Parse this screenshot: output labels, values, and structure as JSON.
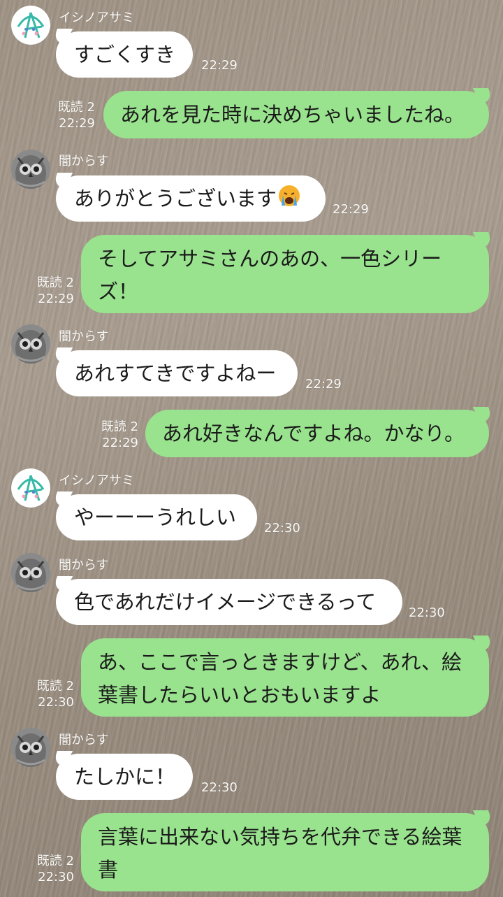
{
  "contacts": {
    "ishino": {
      "name": "イシノアサミ",
      "avatar_icon": "leaf-logo-avatar-icon"
    },
    "yami": {
      "name": "闇からす",
      "avatar_icon": "owl-avatar-icon"
    }
  },
  "messages": [
    {
      "text": "すごくすき",
      "time": "22:29"
    },
    {
      "read": "既読 2",
      "time": "22:29",
      "text": "あれを見た時に決めちゃいましたね。"
    },
    {
      "text": "ありがとうございます",
      "emoji": "crying-face-emoji",
      "time": "22:29"
    },
    {
      "read": "既読 2",
      "time": "22:29",
      "text": "そしてアサミさんのあの、一色シリーズ！"
    },
    {
      "text": "あれすてきですよねー",
      "time": "22:29"
    },
    {
      "read": "既読 2",
      "time": "22:29",
      "text": "あれ好きなんですよね。かなり。"
    },
    {
      "text": "やーーーうれしい",
      "time": "22:30"
    },
    {
      "text": "色であれだけイメージできるって",
      "time": "22:30"
    },
    {
      "read": "既読 2",
      "time": "22:30",
      "text": "あ、ここで言っときますけど、あれ、絵葉書したらいいとおもいますよ"
    },
    {
      "text": "たしかに！",
      "time": "22:30"
    },
    {
      "read": "既読 2",
      "time": "22:30",
      "text": "言葉に出来ない気持ちを代弁できる絵葉書"
    }
  ],
  "colors": {
    "incoming": "#ffffff",
    "outgoing": "#99e38e",
    "meta_text": "#fbfaf8"
  }
}
